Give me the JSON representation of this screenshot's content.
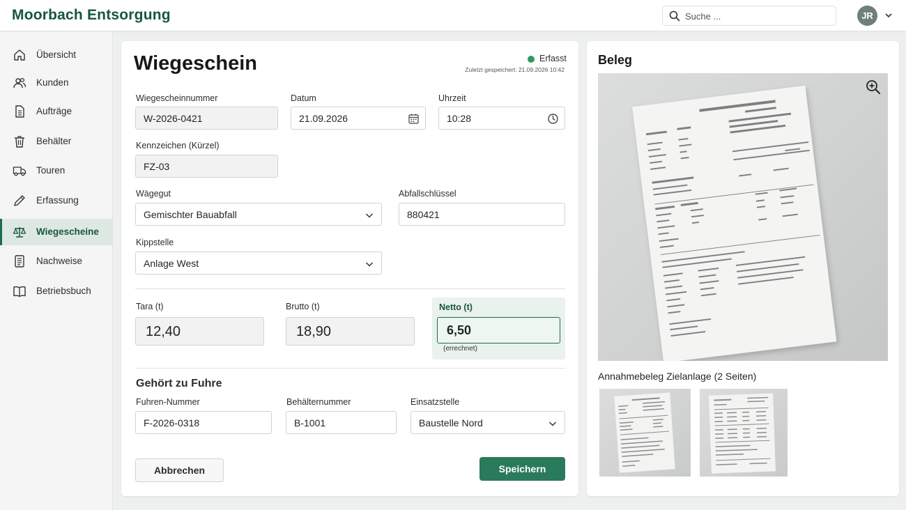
{
  "app": {
    "brand": "Moorbach Entsorgung",
    "search_placeholder": "Suche ...",
    "user_initials": "JR"
  },
  "sidebar": {
    "items": [
      {
        "label": "Übersicht",
        "icon": "home-icon"
      },
      {
        "label": "Kunden",
        "icon": "users-icon"
      },
      {
        "label": "Aufträge",
        "icon": "document-icon"
      },
      {
        "label": "Behälter",
        "icon": "trash-icon"
      },
      {
        "label": "Touren",
        "icon": "truck-icon"
      },
      {
        "label": "Erfassung",
        "icon": "pencil-icon"
      },
      {
        "label": "Wiegescheine",
        "icon": "scale-icon",
        "active": true
      },
      {
        "label": "Nachweise",
        "icon": "list-document-icon"
      },
      {
        "label": "Betriebsbuch",
        "icon": "book-icon"
      }
    ]
  },
  "form": {
    "title": "Wiegeschein",
    "status": "Erfasst",
    "last_saved": "Zuletzt gespeichert: 21.09.2026 10:42",
    "fields": {
      "number": {
        "label": "Wiegescheinnummer",
        "value": "W-2026-0421"
      },
      "date": {
        "label": "Datum",
        "value": "21.09.2026"
      },
      "time": {
        "label": "Uhrzeit",
        "value": "10:28"
      },
      "plate": {
        "label": "Kennzeichen (Kürzel)",
        "value": "FZ-03"
      },
      "material": {
        "label": "Wägegut",
        "value": "Gemischter Bauabfall"
      },
      "waste_key": {
        "label": "Abfallschlüssel",
        "value": "880421"
      },
      "dump_site": {
        "label": "Kippstelle",
        "value": "Anlage West"
      }
    },
    "weights": {
      "tara": {
        "label": "Tara (t)",
        "value": "12,40"
      },
      "brutto": {
        "label": "Brutto (t)",
        "value": "18,90"
      },
      "netto": {
        "label": "Netto (t)",
        "value": "6,50",
        "note": "(errechnet)"
      }
    },
    "trip": {
      "title": "Gehört zu Fuhre",
      "trip_number": {
        "label": "Fuhren-Nummer",
        "value": "F-2026-0318"
      },
      "container": {
        "label": "Behälternummer",
        "value": "B-1001"
      },
      "site": {
        "label": "Einsatzstelle",
        "value": "Baustelle Nord"
      }
    },
    "buttons": {
      "cancel": "Abbrechen",
      "save": "Speichern"
    }
  },
  "beleg": {
    "title": "Beleg",
    "caption": "Annahmebeleg Zielanlage (2 Seiten)",
    "pages": 2
  },
  "colors": {
    "brand": "#17563f",
    "primary_button": "#2a7a5c",
    "status_dot": "#2e9c5f",
    "active_nav_bg": "#dde8e3"
  }
}
